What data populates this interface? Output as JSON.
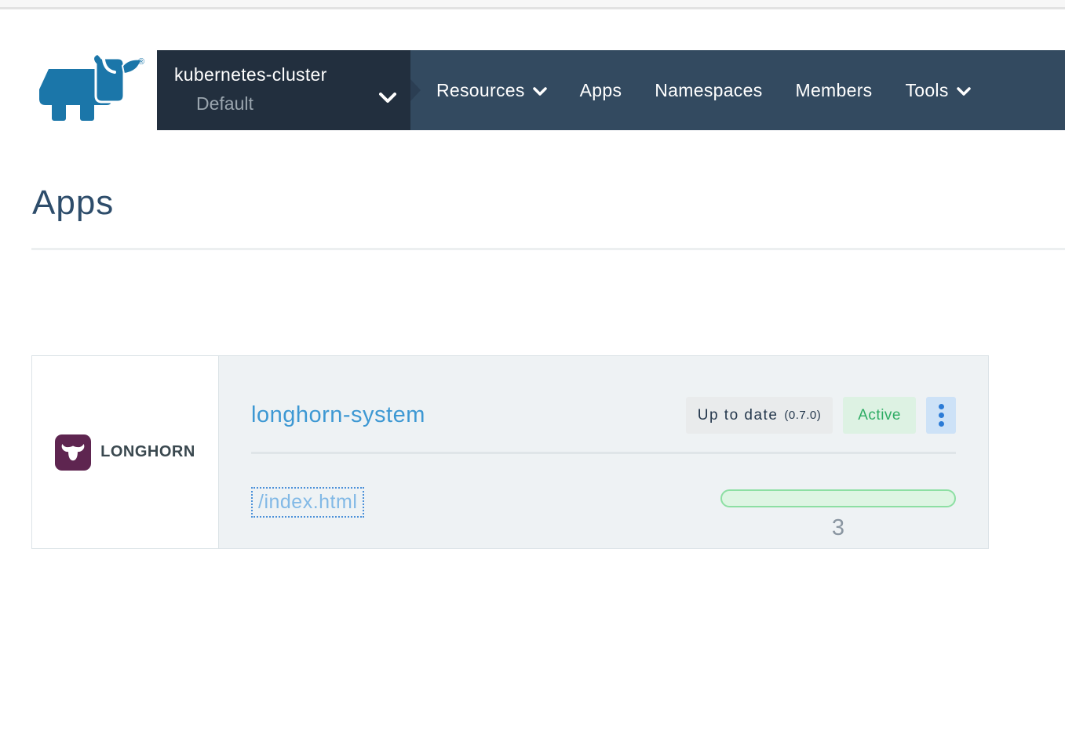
{
  "header": {
    "registered_mark": "®",
    "cluster": {
      "name": "kubernetes-cluster",
      "project": "Default"
    },
    "nav_items": [
      {
        "label": "Resources",
        "has_dropdown": true
      },
      {
        "label": "Apps",
        "has_dropdown": false
      },
      {
        "label": "Namespaces",
        "has_dropdown": false
      },
      {
        "label": "Members",
        "has_dropdown": false
      },
      {
        "label": "Tools",
        "has_dropdown": true
      }
    ]
  },
  "page": {
    "title": "Apps"
  },
  "app_card": {
    "name": "longhorn-system",
    "logo_text": "LONGHORN",
    "upgrade_badge": {
      "text": "Up to date",
      "version": "(0.7.0)"
    },
    "status_badge": "Active",
    "endpoint": "/index.html",
    "pod_count": "3"
  },
  "icons": {
    "rancher-logo": "blue cow/bull mark",
    "longhorn-logo-icon": "white bull skull on purple square",
    "chevron-down-icon": "dropdown caret",
    "kebab-menu-icon": "three vertical dots",
    "breadcrumb-arrow": "right-pointing notch"
  },
  "colors": {
    "nav_dark": "#222f3e",
    "nav_light": "#334a60",
    "rancher_blue": "#1b76a9",
    "link_blue": "#3d98d3",
    "status_green": "#2eac64",
    "longhorn_purple": "#5e2550",
    "card_bg": "#eef2f4"
  }
}
